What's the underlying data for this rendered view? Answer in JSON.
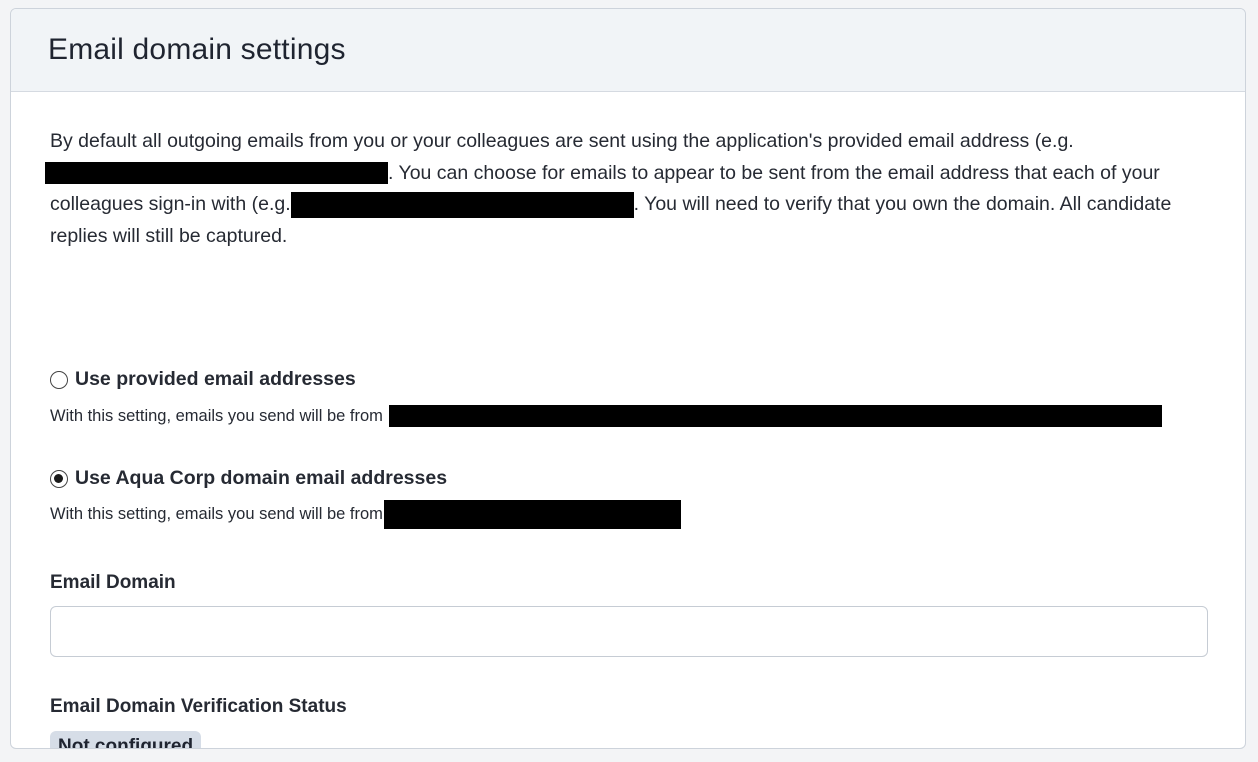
{
  "header": {
    "title": "Email domain settings"
  },
  "intro": {
    "part1": "By default all outgoing emails from you or your colleagues are sent using the application's provided email address (e.g.",
    "part2": ". You can choose for emails to appear to be sent from the email address that each of your colleagues sign-in with (e.g.",
    "part3": ". You will need to verify that you own the domain. All candidate replies will still be captured."
  },
  "options": [
    {
      "label": "Use provided email addresses",
      "hint": "With this setting, emails you send will be from",
      "checked": false
    },
    {
      "label": "Use Aqua Corp domain email addresses",
      "hint": "With this setting, emails you send will be from",
      "checked": true
    }
  ],
  "email_domain": {
    "label": "Email Domain",
    "value": "",
    "placeholder": ""
  },
  "verification": {
    "label": "Email Domain Verification Status",
    "status": "Not configured"
  },
  "colors": {
    "header_bg": "#f1f4f7",
    "badge_bg": "#d6dde7",
    "redaction": "#000000"
  }
}
